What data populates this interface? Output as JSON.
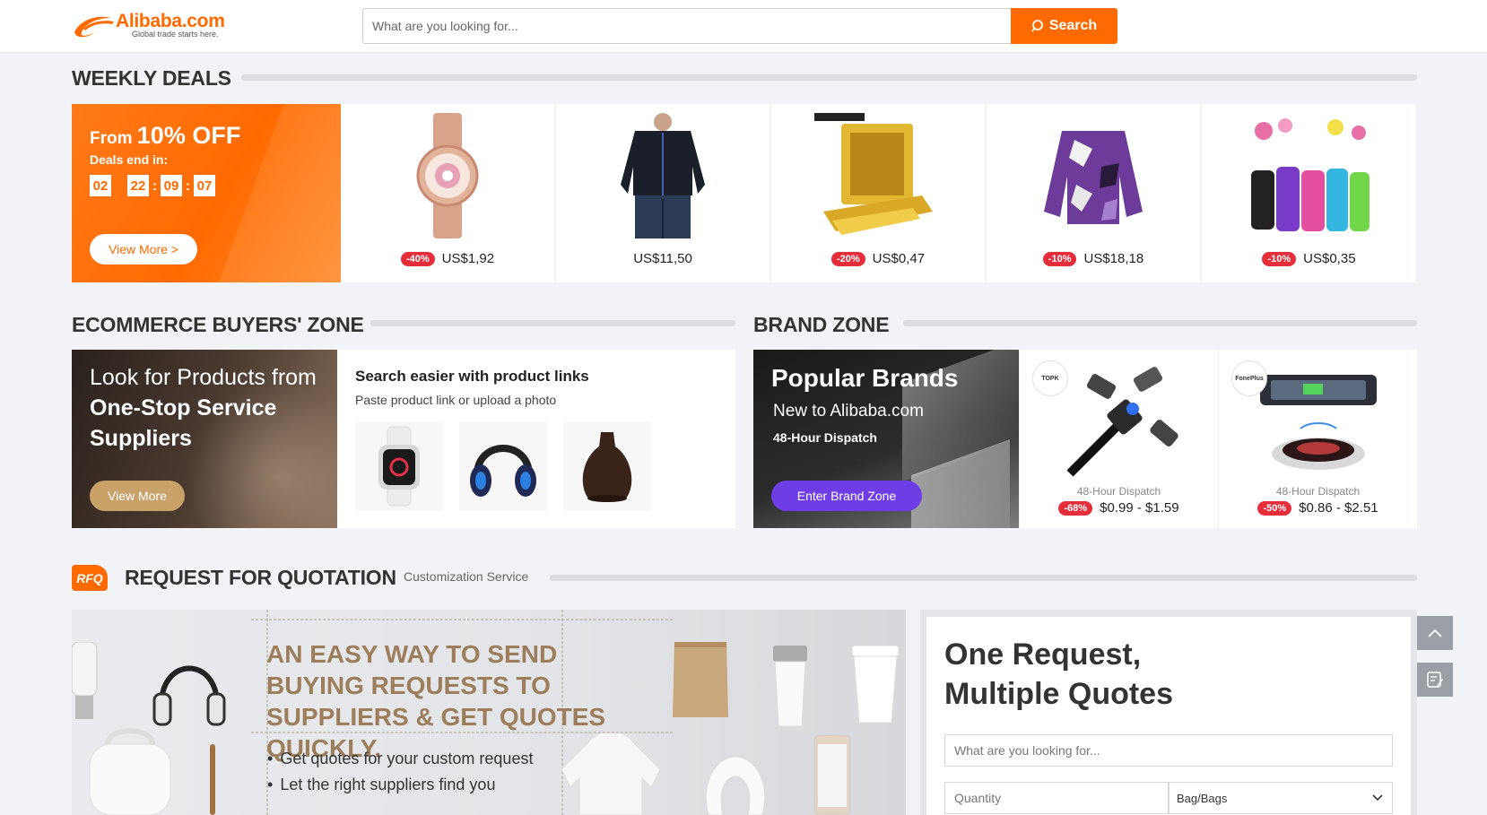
{
  "header": {
    "logo_text": "Alibaba.com",
    "tagline": "Global trade starts here.",
    "search_placeholder": "What are you looking for...",
    "search_button": "Search"
  },
  "weekly_deals": {
    "title": "WEEKLY DEALS",
    "promo": {
      "from_label": "From",
      "discount": "10% OFF",
      "ends_label": "Deals end in:",
      "timer": [
        "02",
        "22",
        "09",
        "07"
      ],
      "button": "View More >"
    },
    "items": [
      {
        "name": "watch",
        "badge": "-40%",
        "price": "US$1,92"
      },
      {
        "name": "jacket",
        "badge": "",
        "price": "US$11,50"
      },
      {
        "name": "gold-bar",
        "badge": "-20%",
        "price": "US$0,47"
      },
      {
        "name": "camo-jacket",
        "badge": "-10%",
        "price": "US$18,18"
      },
      {
        "name": "towels",
        "badge": "-10%",
        "price": "US$0,35"
      }
    ]
  },
  "ecommerce_zone": {
    "title": "ECOMMERCE BUYERS' ZONE",
    "hero": {
      "line1": "Look for Products from",
      "line2": "One-Stop Service",
      "line3": "Suppliers",
      "button": "View More"
    },
    "panel": {
      "heading": "Search easier with product links",
      "subheading": "Paste product link or upload a photo"
    }
  },
  "brand_zone": {
    "title": "BRAND ZONE",
    "hero": {
      "title": "Popular Brands",
      "subtitle": "New to Alibaba.com",
      "dispatch": "48-Hour Dispatch",
      "button": "Enter Brand Zone"
    },
    "products": [
      {
        "brand": "TOPK",
        "dispatch": "48-Hour Dispatch",
        "badge": "-68%",
        "price": "$0.99 - $1.59"
      },
      {
        "brand": "FonePlus",
        "dispatch": "48-Hour Dispatch",
        "badge": "-50%",
        "price": "$0.86 - $2.51"
      }
    ]
  },
  "rfq": {
    "icon_text": "RFQ",
    "title": "REQUEST FOR QUOTATION",
    "subtitle": "Customization Service",
    "banner_heading": "AN EASY WAY TO SEND BUYING REQUESTS TO SUPPLIERS & GET QUOTES QUICKLY.",
    "bullets": [
      "Get quotes for your custom request",
      "Let the right suppliers find you"
    ],
    "form": {
      "heading_line1": "One Request,",
      "heading_line2": "Multiple Quotes",
      "product_placeholder": "What are you looking for...",
      "quantity_placeholder": "Quantity",
      "unit_selected": "Bag/Bags"
    }
  },
  "colors": {
    "accent": "#ff6a00",
    "badge": "#e62e3b",
    "brand_button": "#6e3de6",
    "ecom_button": "#c9a26a"
  }
}
